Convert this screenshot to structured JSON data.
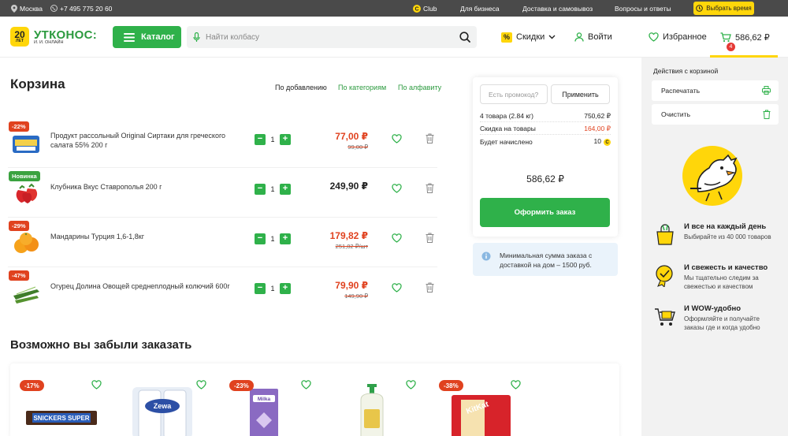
{
  "topbar": {
    "city": "Москва",
    "phone": "+7 495 775 20 60",
    "club": "Club",
    "business": "Для бизнеса",
    "delivery": "Доставка и самовывоз",
    "faq": "Вопросы и ответы",
    "choose_time": "Выбрать время"
  },
  "header": {
    "logo_number": "20",
    "logo_years": "ЛЕТ",
    "logo_name": "УТКОНОС:",
    "logo_sub": "И. И. ОНЛАЙН",
    "catalog_label": "Каталог",
    "search_placeholder": "Найти колбасу",
    "discounts_badge": "%",
    "discounts_label": "Скидки",
    "login_label": "Войти",
    "favorites_label": "Избранное",
    "cart_count": "4",
    "cart_total": "586,62 ₽"
  },
  "cart": {
    "title": "Корзина",
    "sort_options": [
      "По добавлению",
      "По категориям",
      "По алфавиту"
    ],
    "items": [
      {
        "badge": "-22%",
        "name": "Продукт рассольный Original Сиртаки для греческого салата 55% 200 г",
        "qty": "1",
        "price": "77,00 ₽",
        "old_price": "99,00 ₽"
      },
      {
        "badge": "Новинка",
        "name": "Клубника Вкус Ставрополья 200 г",
        "qty": "1",
        "price": "249,90 ₽",
        "old_price": ""
      },
      {
        "badge": "-29%",
        "name": "Мандарины Турция 1,6-1,8кг",
        "qty": "1",
        "price": "179,82 ₽",
        "old_price": "251,82 ₽/шт"
      },
      {
        "badge": "-47%",
        "name": "Огурец Долина Овощей среднеплодный колючий 600г",
        "qty": "1",
        "price": "79,90 ₽",
        "old_price": "149,90 ₽"
      }
    ]
  },
  "summary": {
    "promo_placeholder": "Есть промокод?",
    "apply_label": "Применить",
    "items_label": "4 товара (2.84 кг)",
    "items_value": "750,62 ₽",
    "discount_label": "Скидка на товары",
    "discount_value": "164,00 ₽",
    "bonus_label": "Будет начислено",
    "bonus_value": "10",
    "bonus_coin": "C",
    "total": "586,62 ₽",
    "order_label": "Оформить заказ",
    "min_note": "Минимальная сумма заказа с доставкой на дом – 1500 руб."
  },
  "reco": {
    "title": "Возможно вы забыли заказать",
    "cards": [
      {
        "badge": "-17%",
        "product": "SNICKERS SUPER"
      },
      {
        "badge": "",
        "product": "Zewa"
      },
      {
        "badge": "-23%",
        "product": "Milka"
      },
      {
        "badge": "",
        "product": ""
      },
      {
        "badge": "-38%",
        "product": "KitKat"
      }
    ]
  },
  "sidebar": {
    "title": "Действия с корзиной",
    "print_label": "Распечатать",
    "clear_label": "Очистить",
    "features": [
      {
        "title": "И все на каждый день",
        "desc": "Выбирайте из 40 000 товаров"
      },
      {
        "title": "И свежесть и качество",
        "desc": "Мы тщательно следим за свежестью и качеством"
      },
      {
        "title": "И WOW-удобно",
        "desc": "Оформляйте и получайте заказы где и когда удобно"
      }
    ]
  },
  "colors": {
    "green": "#2fb14a",
    "yellow": "#ffd60a",
    "red": "#e0421f",
    "topbar": "#4a4a4a"
  }
}
